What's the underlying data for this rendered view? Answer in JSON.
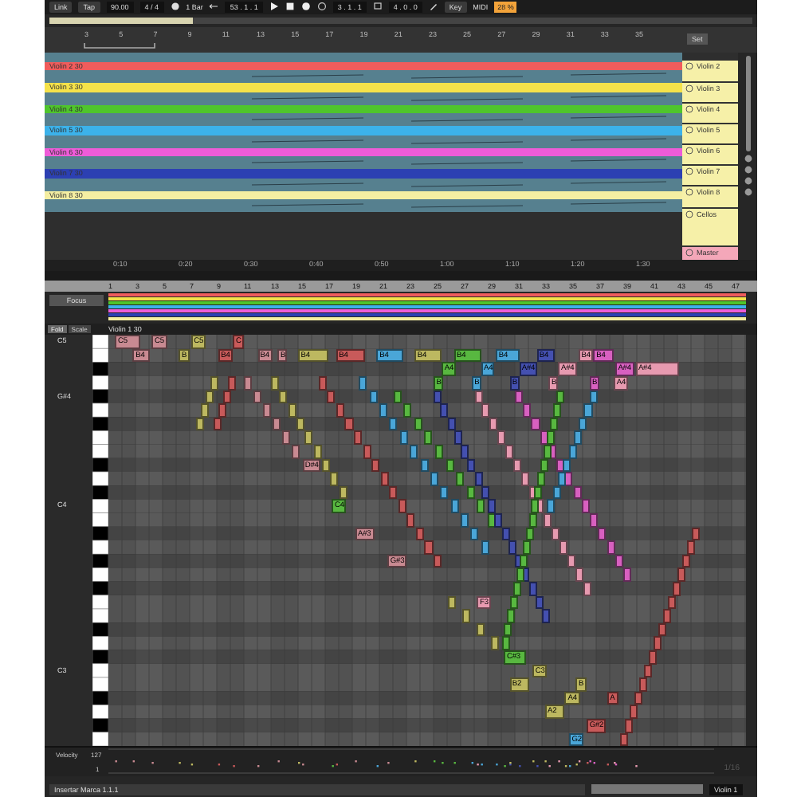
{
  "transport": {
    "link": "Link",
    "tap": "Tap",
    "tempo": "90.00",
    "signature": "4 / 4",
    "quantize": "1 Bar",
    "position": "53 . 1 . 1",
    "loop_start": "3 . 1 . 1",
    "loop_length": "4 . 0 . 0",
    "key": "Key",
    "midi": "MIDI",
    "cpu": "28 %"
  },
  "arrangement": {
    "ruler": [
      "3",
      "5",
      "7",
      "9",
      "11",
      "13",
      "15",
      "17",
      "19",
      "21",
      "23",
      "25",
      "27",
      "29",
      "31",
      "33",
      "35"
    ],
    "set": "Set",
    "tracks": [
      {
        "name": "Violin 2",
        "clip": "Violin 2 30",
        "color": "#f05c5c"
      },
      {
        "name": "Violin 3",
        "clip": "Violin 3 30",
        "color": "#f5e24a"
      },
      {
        "name": "Violin 4",
        "clip": "Violin 4 30",
        "color": "#4fc52c"
      },
      {
        "name": "Violin 5",
        "clip": "Violin 5 30",
        "color": "#3cb2ea"
      },
      {
        "name": "Violin 6",
        "clip": "Violin 6 30",
        "color": "#ee5cd8"
      },
      {
        "name": "Violin 7",
        "clip": "Violin 7 30",
        "color": "#2c40b2"
      },
      {
        "name": "Violin 8",
        "clip": "Violin 8 30",
        "color": "#f4eea2"
      },
      {
        "name": "Cellos"
      }
    ],
    "master": "Master",
    "time_ruler": [
      "0:10",
      "0:20",
      "0:30",
      "0:40",
      "0:50",
      "1:00",
      "1:10",
      "1:20",
      "1:30"
    ]
  },
  "clip": {
    "focus": "Focus",
    "fold": "Fold",
    "scale": "Scale",
    "name": "Violin 1 30",
    "ruler": [
      "1",
      "3",
      "5",
      "7",
      "9",
      "11",
      "13",
      "15",
      "17",
      "19",
      "21",
      "23",
      "25",
      "27",
      "29",
      "31",
      "33",
      "35",
      "37",
      "39",
      "41",
      "43",
      "45",
      "47"
    ],
    "key_labels": [
      "C5",
      "G#4",
      "C4",
      "C3"
    ],
    "notes": [
      {
        "label": "C5",
        "color": "#c98a92"
      },
      {
        "label": "C5",
        "color": "#c98a92"
      },
      {
        "label": "C5",
        "color": "#bdb860"
      },
      {
        "label": "C",
        "color": "#c85a5a"
      },
      {
        "label": "B4",
        "color": "#c98a92"
      },
      {
        "label": "B",
        "color": "#bdb860"
      },
      {
        "label": "B4",
        "color": "#c85a5a"
      },
      {
        "label": "B4",
        "color": "#c98a92"
      },
      {
        "label": "B",
        "color": "#c98a92"
      },
      {
        "label": "B4",
        "color": "#bdb860"
      },
      {
        "label": "B4",
        "color": "#c85a5a"
      },
      {
        "label": "B4",
        "color": "#4aa6d8"
      },
      {
        "label": "B4",
        "color": "#bdb860"
      },
      {
        "label": "B4",
        "color": "#58b840"
      },
      {
        "label": "B4",
        "color": "#4aa6d8"
      },
      {
        "label": "B4",
        "color": "#4450b0"
      },
      {
        "label": "B4",
        "color": "#e79ab0"
      },
      {
        "label": "A4",
        "color": "#58b840"
      },
      {
        "label": "A4",
        "color": "#4aa6d8"
      },
      {
        "label": "A#4",
        "color": "#4450b0"
      },
      {
        "label": "A#4",
        "color": "#e79ab0"
      },
      {
        "label": "B4",
        "color": "#d860c0"
      },
      {
        "label": "A#4",
        "color": "#d860c0"
      },
      {
        "label": "A#4",
        "color": "#e79ab0"
      },
      {
        "label": "B",
        "color": "#58b840"
      },
      {
        "label": "B",
        "color": "#4aa6d8"
      },
      {
        "label": "B",
        "color": "#4450b0"
      },
      {
        "label": "B",
        "color": "#e79ab0"
      },
      {
        "label": "B",
        "color": "#d860c0"
      },
      {
        "label": "A4",
        "color": "#e79ab0"
      },
      {
        "label": "D#4",
        "color": "#c98a92"
      },
      {
        "label": "C4",
        "color": "#58b840"
      },
      {
        "label": "A#3",
        "color": "#c98a92"
      },
      {
        "label": "G#3",
        "color": "#c98a92"
      },
      {
        "label": "F3",
        "color": "#e79ab0"
      },
      {
        "label": "C#3",
        "color": "#58b840"
      },
      {
        "label": "C3",
        "color": "#bdb860"
      },
      {
        "label": "B2",
        "color": "#bdb860"
      },
      {
        "label": "B",
        "color": "#bdb860"
      },
      {
        "label": "A4",
        "color": "#bdb860"
      },
      {
        "label": "A2",
        "color": "#bdb860"
      },
      {
        "label": "G#2",
        "color": "#c85a5a"
      },
      {
        "label": "A",
        "color": "#c85a5a"
      },
      {
        "label": "G2",
        "color": "#4aa6d8"
      }
    ],
    "velocity": {
      "label": "Velocity",
      "max": "127",
      "min": "1",
      "grid": "1/16"
    }
  },
  "status_bar": {
    "message": "Insertar Marca 1.1.1",
    "track": "Violin 1"
  }
}
